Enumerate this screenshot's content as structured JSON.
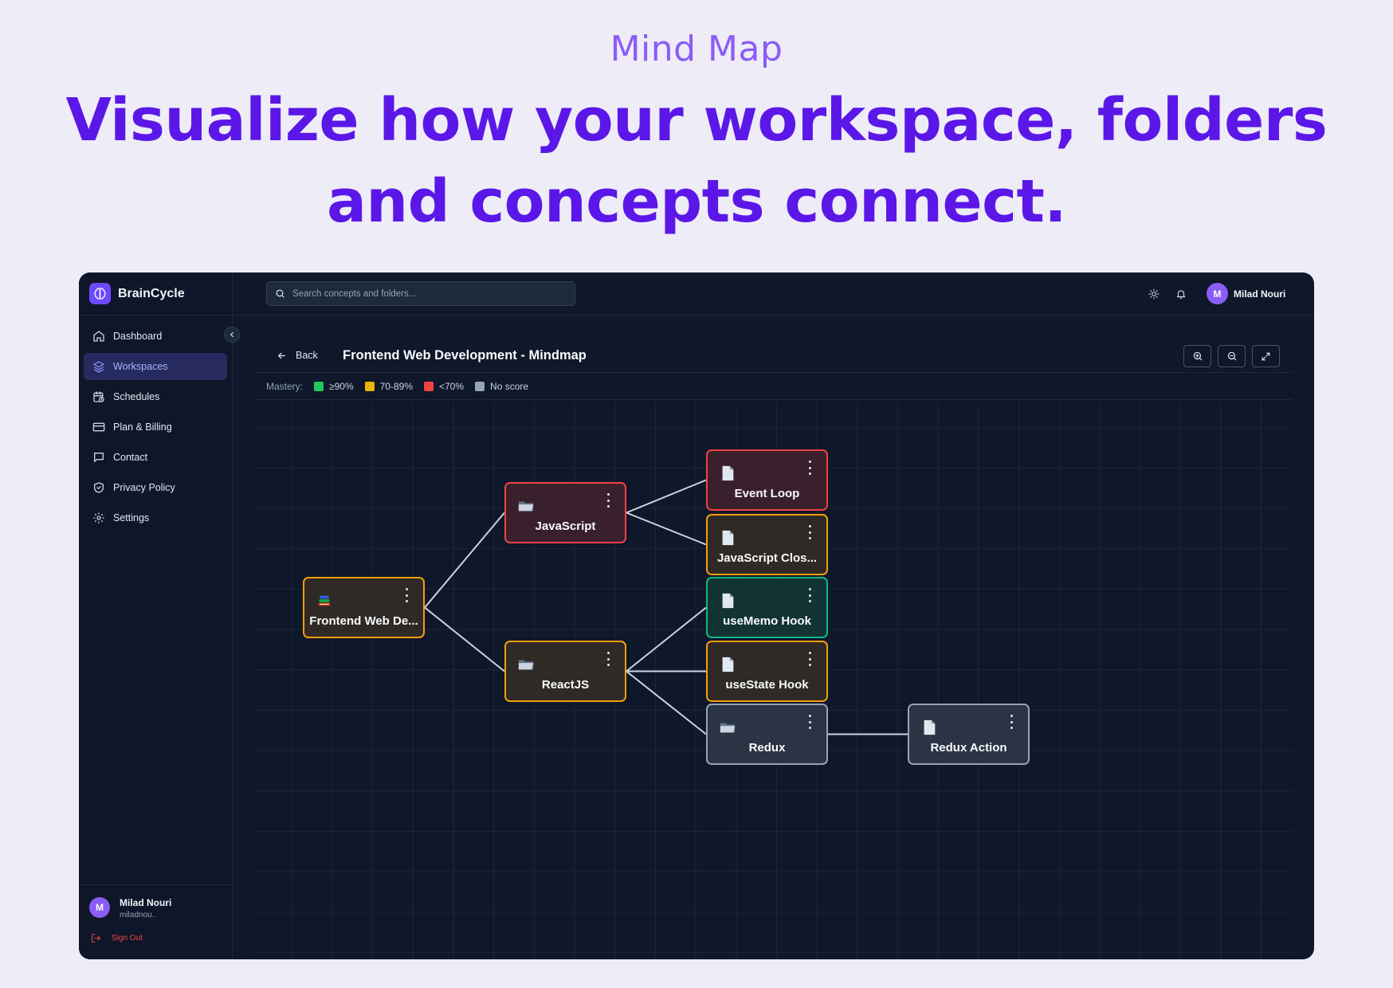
{
  "hero": {
    "eyebrow": "Mind Map",
    "headline": "Visualize how your workspace, folders and concepts connect."
  },
  "app": {
    "brand": "BrainCycle",
    "accent_color": "#6d4aff",
    "sidebar": {
      "items": [
        {
          "label": "Dashboard",
          "icon": "home-icon",
          "active": false
        },
        {
          "label": "Workspaces",
          "icon": "layers-icon",
          "active": true
        },
        {
          "label": "Schedules",
          "icon": "calendar-clock-icon",
          "active": false
        },
        {
          "label": "Plan & Billing",
          "icon": "credit-card-icon",
          "active": false
        },
        {
          "label": "Contact",
          "icon": "message-icon",
          "active": false
        },
        {
          "label": "Privacy Policy",
          "icon": "shield-check-icon",
          "active": false
        },
        {
          "label": "Settings",
          "icon": "gear-icon",
          "active": false
        }
      ],
      "user": {
        "initial": "M",
        "name": "Milad Nouri",
        "email_visible": "miladnou...c..."
      },
      "sign_out": "Sign Out"
    },
    "topbar": {
      "search_placeholder": "Search concepts and folders...",
      "user_initial": "M",
      "user_name": "Milad Nouri"
    },
    "content": {
      "back_label": "Back",
      "title": "Frontend Web Development - Mindmap",
      "mastery": {
        "label": "Mastery:",
        "legend": [
          {
            "label": "≥90%",
            "color": "#22c55e"
          },
          {
            "label": "70-89%",
            "color": "#eab308"
          },
          {
            "label": "<70%",
            "color": "#ef4444"
          },
          {
            "label": "No score",
            "color": "#94a3b8"
          }
        ]
      }
    },
    "mindmap": {
      "nodes": [
        {
          "id": "root",
          "label": "Frontend Web De...",
          "kind": "workspace",
          "mastery": "yellow"
        },
        {
          "id": "js",
          "label": "JavaScript",
          "kind": "folder",
          "mastery": "red"
        },
        {
          "id": "react",
          "label": "ReactJS",
          "kind": "folder",
          "mastery": "yellow"
        },
        {
          "id": "eventloop",
          "label": "Event Loop",
          "kind": "concept",
          "mastery": "red"
        },
        {
          "id": "closures",
          "label": "JavaScript Clos...",
          "kind": "concept",
          "mastery": "yellow"
        },
        {
          "id": "usememo",
          "label": "useMemo Hook",
          "kind": "concept",
          "mastery": "green"
        },
        {
          "id": "usestate",
          "label": "useState Hook",
          "kind": "concept",
          "mastery": "yellow"
        },
        {
          "id": "redux",
          "label": "Redux",
          "kind": "folder",
          "mastery": "gray"
        },
        {
          "id": "reduxaction",
          "label": "Redux Action",
          "kind": "concept",
          "mastery": "gray"
        }
      ],
      "edges": [
        [
          "root",
          "js"
        ],
        [
          "root",
          "react"
        ],
        [
          "js",
          "eventloop"
        ],
        [
          "js",
          "closures"
        ],
        [
          "react",
          "usememo"
        ],
        [
          "react",
          "usestate"
        ],
        [
          "react",
          "redux"
        ],
        [
          "redux",
          "reduxaction"
        ]
      ]
    }
  }
}
